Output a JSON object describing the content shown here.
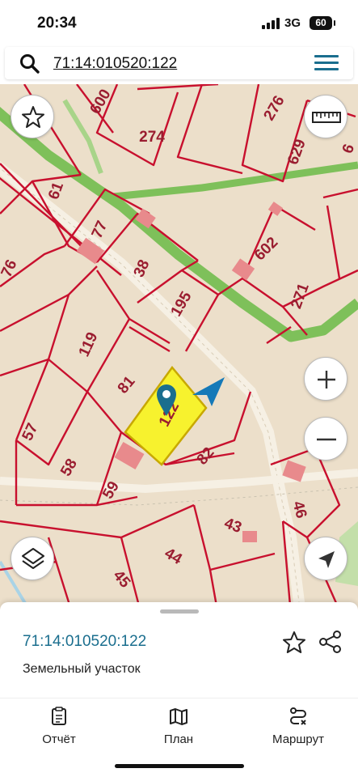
{
  "status_bar": {
    "time": "20:34",
    "network": "3G",
    "battery": "60"
  },
  "search": {
    "value": "71:14:010520:122"
  },
  "map": {
    "parcel_numbers": [
      "600",
      "274",
      "276",
      "629",
      "6",
      "61",
      "77",
      "76",
      "38",
      "602",
      "195",
      "271",
      "119",
      "81",
      "122",
      "57",
      "58",
      "82",
      "59",
      "46",
      "43",
      "44",
      "45"
    ],
    "selected_parcel": "122",
    "colors": {
      "ground": "#ecdfca",
      "boundary": "#c8102e",
      "selected_fill": "#f7f22e",
      "green_strip": "#7ec05a",
      "marker": "#1a6e8e",
      "direction": "#1579b8"
    }
  },
  "sheet": {
    "cadastral_number": "71:14:010520:122",
    "land_type": "Земельный участок"
  },
  "tabs": [
    {
      "label": "Отчёт",
      "icon": "report-icon"
    },
    {
      "label": "План",
      "icon": "map-plan-icon"
    },
    {
      "label": "Маршрут",
      "icon": "route-icon"
    }
  ]
}
